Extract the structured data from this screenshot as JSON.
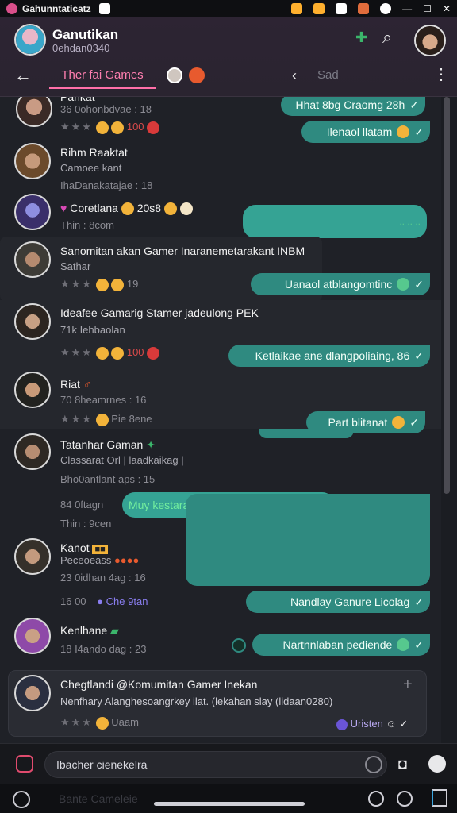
{
  "status": {
    "app_title": "Gahunntaticatz",
    "icons": [
      "warning-icon",
      "notification-icon",
      "photo-icon",
      "sync-icon",
      "minimize-icon",
      "maximize-icon",
      "close-icon"
    ]
  },
  "header": {
    "channel_name": "Ganutikan",
    "channel_sub": "0ehdan0340",
    "tabs": [
      {
        "label": "Ther fai Games"
      }
    ],
    "share_label": "Sad"
  },
  "messages": [
    {
      "name": "Pankat",
      "sub": "",
      "meta": "36 0ohonbdvae : 18",
      "reactions": "100",
      "bubble": "Hhat 8bg Craomg 28h",
      "bubble2": "Ilenaol llatam"
    },
    {
      "name": "Rihm Raaktat",
      "sub": "Camoee kant",
      "meta": "IhaDanakatajae : 18",
      "reactions": ""
    },
    {
      "name": "Coretlana",
      "sub": "",
      "meta": "Thin : 8com",
      "reactions": "20s8",
      "bubble": ""
    },
    {
      "name": "Sanomitan akan Gamer Inaranemetarakant INBM",
      "sub": "Sathar",
      "meta": "",
      "reactions": "19",
      "bubble": "Uanaol atblangomtinc"
    },
    {
      "name": "Ideafee Gamarig Stamer jadeulong PEK",
      "sub": "71k Iehbaolan",
      "meta": "",
      "reactions": "100",
      "bubble": "Ketlaikae ane dlangpoliaing, 86"
    },
    {
      "name": "Riat",
      "sub": "",
      "meta": "70 8heamrnes : 16",
      "reactions": "Pie 8ene",
      "bubble": "Part blitanat"
    },
    {
      "name": "Tatanhar Gaman",
      "sub": "Classarat Orl | laadkaikag |",
      "meta": "Bho0antlant aps : 15",
      "reactions": "",
      "bubble": ""
    },
    {
      "name": "",
      "sub": "",
      "meta": "84 0ftagn",
      "meta2": "Thin : 9cen",
      "bubble": "Muy kestararlesterhrelthlangi ele"
    },
    {
      "name": "Kanot",
      "sub": "Peceoeass",
      "meta": "23 0idhan 4ag : 16",
      "reactions": ""
    },
    {
      "name": "",
      "sub": "",
      "meta": "16 00",
      "reactions": "Che 9tan",
      "bubble": "Nandlay Ganure Licolag"
    },
    {
      "name": "Kenlhane",
      "sub": "",
      "meta": "18 I4ando dag : 23",
      "bubble": "Nartnnlaban pediende"
    },
    {
      "name": "Chegtlandi @Komumitan Gamer Inekan",
      "sub": "Nenfhary Alanghesoangrkey ilat. (lekahan slay (lidaan0280)",
      "meta": "",
      "reactions": "Uaam",
      "badge": "Uristen"
    }
  ],
  "composer": {
    "placeholder": "Ibacher cienekelra"
  },
  "navbar": {
    "label": "Bante Cameleie"
  },
  "colors": {
    "accent": "#2f8a80",
    "tab_accent": "#ff6fa8",
    "bg": "#1f2127"
  }
}
